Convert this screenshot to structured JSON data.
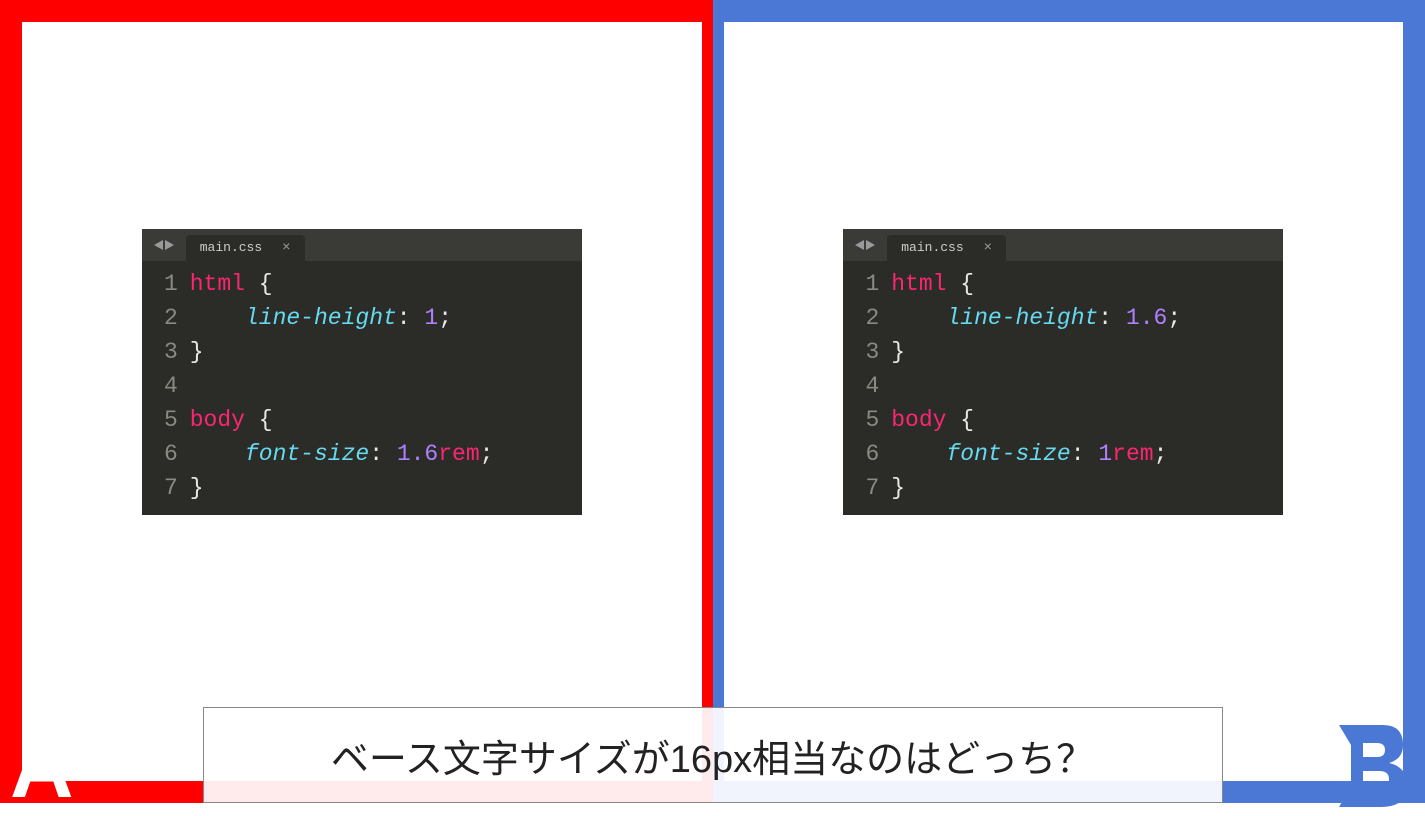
{
  "panels": {
    "a": {
      "label": "A",
      "color": "#ff0000",
      "editor": {
        "filename": "main.css",
        "lines": [
          "1",
          "2",
          "3",
          "4",
          "5",
          "6",
          "7"
        ],
        "code": {
          "l1_sel": "html",
          "l2_prop": "line-height",
          "l2_val": "1",
          "l5_sel": "body",
          "l6_prop": "font-size",
          "l6_val": "1.6",
          "l6_unit": "rem"
        }
      }
    },
    "b": {
      "label": "B",
      "color": "#4a78d4",
      "editor": {
        "filename": "main.css",
        "lines": [
          "1",
          "2",
          "3",
          "4",
          "5",
          "6",
          "7"
        ],
        "code": {
          "l1_sel": "html",
          "l2_prop": "line-height",
          "l2_val": "1.6",
          "l5_sel": "body",
          "l6_prop": "font-size",
          "l6_val": "1",
          "l6_unit": "rem"
        }
      }
    }
  },
  "question": "ベース文字サイズが16px相当なのはどっち？"
}
